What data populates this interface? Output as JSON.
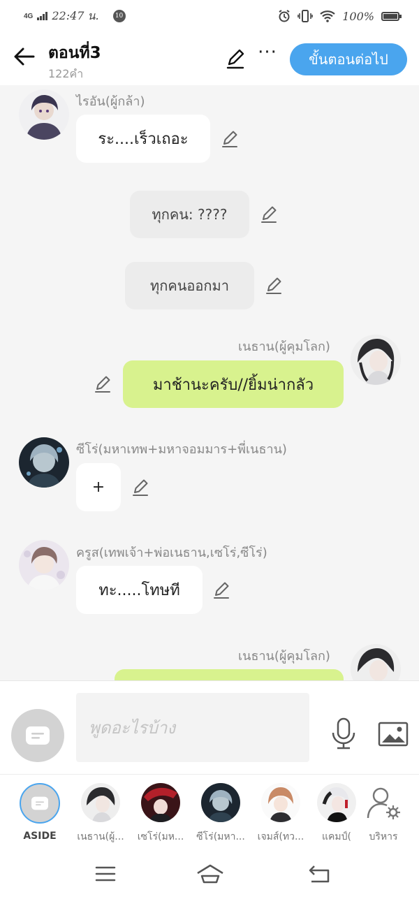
{
  "status": {
    "network": "4G",
    "time": "22:47 น.",
    "notification_count": "10",
    "battery": "100%"
  },
  "header": {
    "title": "ตอนที่3",
    "word_count": "122คำ",
    "next_button": "ขั้นตอนต่อไป",
    "more": "···"
  },
  "messages": [
    {
      "type": "left",
      "sender": "ไรอัน(ผู้กล้า)",
      "text": "ระ....เร็วเถอะ",
      "avatar": "avatar-rayan"
    },
    {
      "type": "narration",
      "text": "ทุกคน: ????"
    },
    {
      "type": "narration",
      "text": "ทุกคนออกมา"
    },
    {
      "type": "right",
      "sender": "เนธาน(ผู้คุมโลก)",
      "text": "มาช้านะครับ//ยิ้มน่ากลัว",
      "avatar": "avatar-nethan"
    },
    {
      "type": "left",
      "sender": "ซีโร่(มหาเทพ+มหาจอมมาร+พี่เนธาน)",
      "text": "+",
      "avatar": "avatar-zero"
    },
    {
      "type": "left",
      "sender": "ครูส(เทพเจ้า+พ่อเนธาน,เซโร่,ซีโร่)",
      "text": "ทะ.....โทษที",
      "avatar": "avatar-krus"
    },
    {
      "type": "right",
      "sender": "เนธาน(ผู้คุมโลก)",
      "text": "",
      "avatar": "avatar-nethan"
    }
  ],
  "input": {
    "placeholder": "พูดอะไรบ้าง"
  },
  "characters": [
    {
      "label": "ASIDE",
      "icon": "aside-icon"
    },
    {
      "label": "เนธาน(ผู้...",
      "icon": "character-avatar"
    },
    {
      "label": "เซโร่(มห...",
      "icon": "character-avatar"
    },
    {
      "label": "ซีโร่(มหา...",
      "icon": "character-avatar"
    },
    {
      "label": "เจมส์(ทว...",
      "icon": "character-avatar"
    },
    {
      "label": "แคมป์(",
      "icon": "character-avatar"
    },
    {
      "label": "บริหาร",
      "icon": "manage-characters-icon"
    }
  ],
  "colors": {
    "accent": "#4aa5ee",
    "bubble_green": "#d8f28e",
    "bubble_white": "#ffffff",
    "narration_grey": "#ececec",
    "background": "#f5f5f5"
  }
}
